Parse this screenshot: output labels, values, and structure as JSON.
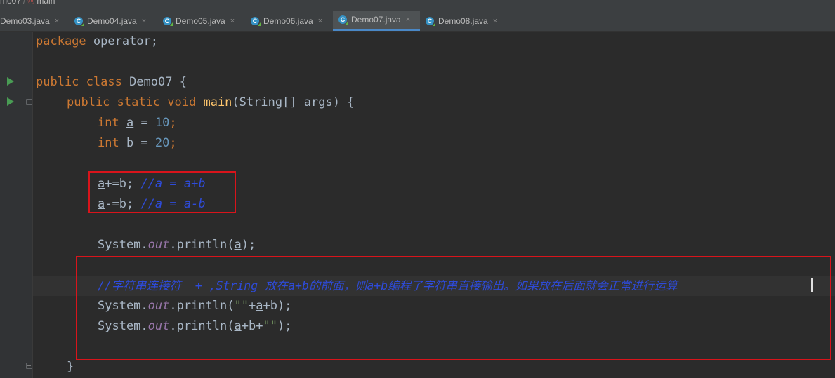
{
  "breadcrumb": {
    "project": "mo07",
    "sep": "/",
    "method": "main"
  },
  "tabs": [
    {
      "label": "Demo03.java",
      "close": "×"
    },
    {
      "label": "Demo04.java",
      "close": "×"
    },
    {
      "label": "Demo05.java",
      "close": "×"
    },
    {
      "label": "Demo06.java",
      "close": "×"
    },
    {
      "label": "Demo07.java",
      "close": "×",
      "active": true
    },
    {
      "label": "Demo08.java",
      "close": "×"
    }
  ],
  "tab_icon_letter": "C",
  "colors": {
    "keyword": "#cc7832",
    "number": "#6897bb",
    "string": "#6a8759",
    "comment": "#2e4bd9",
    "field": "#9876aa",
    "highlight_box": "#d9141b",
    "active_tab_underline": "#4a88c7",
    "run_icon": "#499c54"
  },
  "icons": {
    "run": "run-gutter-icon",
    "fold": "fold-icon",
    "class": "class-c-icon"
  },
  "code": {
    "l1_kw": "package",
    "l1_rest": " operator;",
    "l3_kw": "public class",
    "l3_rest": " Demo07 {",
    "l4_kw": "public static void",
    "l4_fn": " main",
    "l4_rest": "(String[] args) {",
    "l5_kw": "int",
    "l5_var": "a",
    "l5_eq": " = ",
    "l5_num": "10",
    "l5_end": ";",
    "l6_kw": "int",
    "l6_var": " b = ",
    "l6_num": "20",
    "l6_end": ";",
    "l8_var": "a",
    "l8_rest": "+=b; ",
    "l8_cmt": "//a = a+b",
    "l9_var": "a",
    "l9_rest": "-=b; ",
    "l9_cmt": "//a = a-b",
    "l11_pre": "System.",
    "l11_fld": "out",
    "l11_mid": ".println(",
    "l11_var": "a",
    "l11_end": ");",
    "l13_cmt": "//字符串连接符  + ,String 放在a+b的前面，则a+b编程了字符串直接输出。如果放在后面就会正常进行运算",
    "l14_pre": "System.",
    "l14_fld": "out",
    "l14_mid": ".println(",
    "l14_str": "\"\"",
    "l14_plus": "+",
    "l14_var": "a",
    "l14_end": "+b);",
    "l15_pre": "System.",
    "l15_fld": "out",
    "l15_mid": ".println(",
    "l15_var": "a",
    "l15_plus": "+b+",
    "l15_str": "\"\"",
    "l15_end": ");",
    "l17_brace": "}"
  }
}
